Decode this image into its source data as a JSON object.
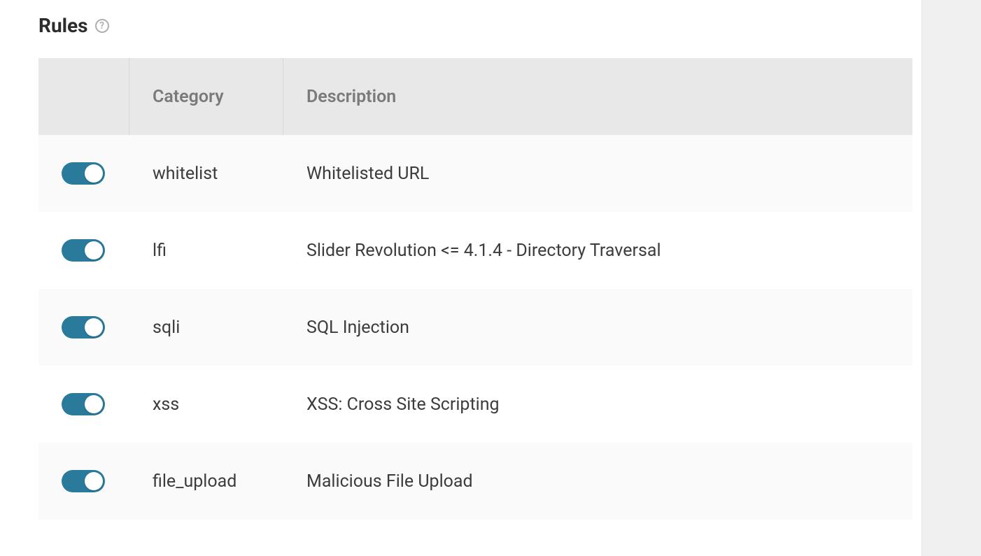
{
  "section": {
    "title": "Rules",
    "help_tooltip": "?"
  },
  "table": {
    "headers": {
      "toggle": "",
      "category": "Category",
      "description": "Description"
    },
    "rows": [
      {
        "enabled": true,
        "category": "whitelist",
        "description": "Whitelisted URL"
      },
      {
        "enabled": true,
        "category": "lfi",
        "description": "Slider Revolution <= 4.1.4 - Directory Traversal"
      },
      {
        "enabled": true,
        "category": "sqli",
        "description": "SQL Injection"
      },
      {
        "enabled": true,
        "category": "xss",
        "description": "XSS: Cross Site Scripting"
      },
      {
        "enabled": true,
        "category": "file_upload",
        "description": "Malicious File Upload"
      }
    ]
  },
  "colors": {
    "toggle_on": "#2a7a9c"
  }
}
